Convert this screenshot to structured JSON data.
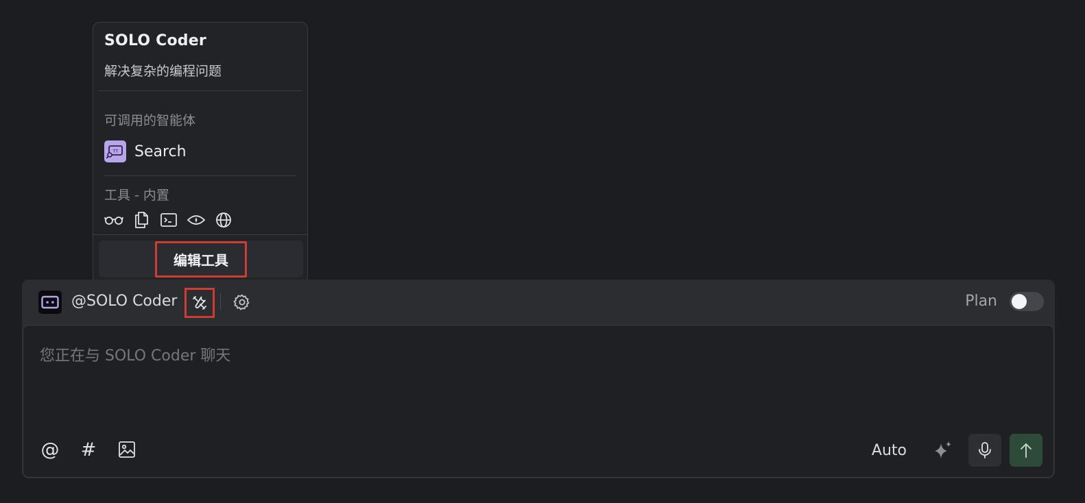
{
  "popup": {
    "agent_name": "SOLO Coder",
    "agent_description": "解决复杂的编程问题",
    "callable_agents_label": "可调用的智能体",
    "callable_agents": [
      {
        "label": "Search",
        "icon": "search-agent-icon"
      }
    ],
    "tools_label": "工具 - 内置",
    "tools": [
      {
        "icon": "glasses-icon"
      },
      {
        "icon": "files-icon"
      },
      {
        "icon": "terminal-icon"
      },
      {
        "icon": "eye-icon"
      },
      {
        "icon": "globe-icon"
      }
    ],
    "edit_tools_label": "编辑工具"
  },
  "chat": {
    "agent_mention": "@SOLO Coder",
    "plan_label": "Plan",
    "plan_enabled": false,
    "input_placeholder": "您正在与 SOLO Coder 聊天",
    "input_value": "",
    "mode_label": "Auto"
  },
  "colors": {
    "background": "#1c1d20",
    "panel": "#2c2d31",
    "accent_purple": "#b9a4ee",
    "highlight_red": "#d23b2f",
    "send_green": "#2e4a39"
  }
}
